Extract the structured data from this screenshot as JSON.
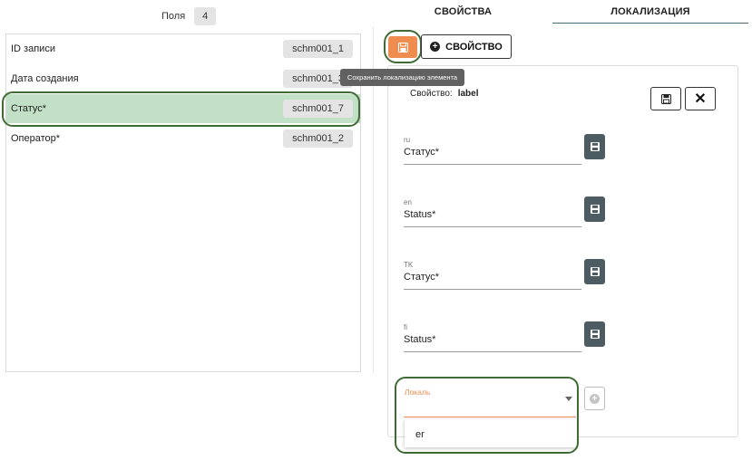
{
  "fields_panel": {
    "label": "Поля",
    "count": "4",
    "items": [
      {
        "name": "ID записи",
        "code": "schm001_1"
      },
      {
        "name": "Дата создания",
        "code": "schm001_3"
      },
      {
        "name": "Статус*",
        "code": "schm001_7"
      },
      {
        "name": "Оператор*",
        "code": "schm001_2"
      }
    ]
  },
  "tabs": [
    {
      "label": "СВОЙСТВА"
    },
    {
      "label": "ЛОКАЛИЗАЦИЯ"
    }
  ],
  "toolbar": {
    "save_icon": "floppy-icon",
    "add_property_label": "СВОЙСТВО",
    "tooltip": "Сохранить локализацию элемента"
  },
  "editor": {
    "property_prefix": "Свойство:",
    "property_name": "label",
    "localizations": [
      {
        "code": "ru",
        "value": "Статус*"
      },
      {
        "code": "en",
        "value": "Status*"
      },
      {
        "code": "TK",
        "value": "Статус*"
      },
      {
        "code": "fi",
        "value": "Status*"
      }
    ],
    "locale_select": {
      "label": "Локаль",
      "value": "",
      "option": "er"
    }
  },
  "colors": {
    "accent_orange": "#ef8c4f",
    "selected_row": "#c2e0c6",
    "dark_button": "#4d5c63",
    "highlight_ring": "#3f6b34"
  }
}
